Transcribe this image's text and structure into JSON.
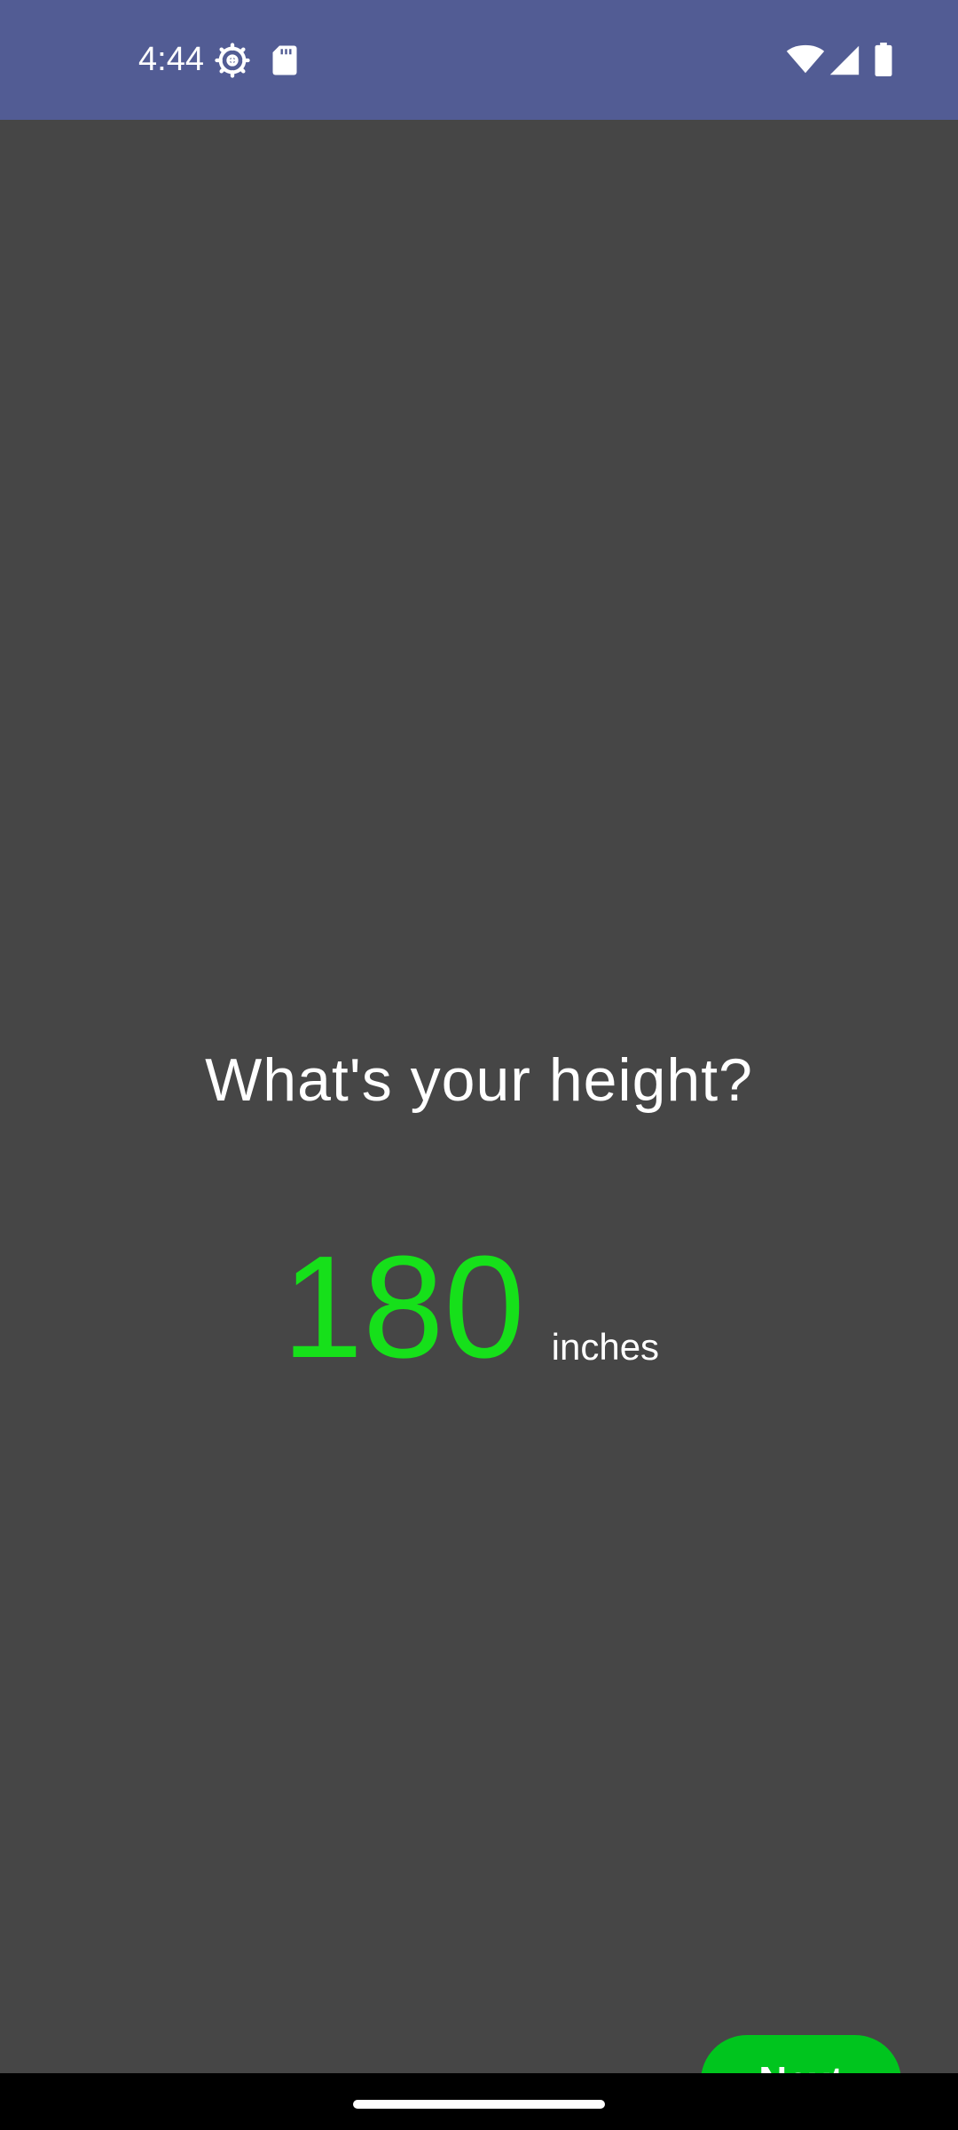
{
  "status_bar": {
    "time": "4:44",
    "icons": [
      "settings-gear-icon",
      "sd-card-icon",
      "wifi-icon",
      "cell-signal-icon",
      "battery-icon"
    ],
    "background_color": "#525c94"
  },
  "screen": {
    "question": "What's your height?",
    "height_value": "180",
    "height_unit": "inches",
    "value_color": "#16e01a",
    "background_color": "#464646"
  },
  "actions": {
    "next_label": "Next",
    "next_color": "#00c51e"
  }
}
